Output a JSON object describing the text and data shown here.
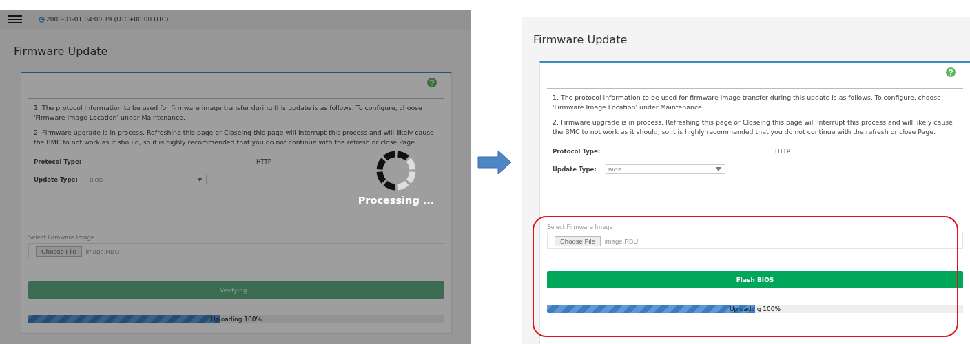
{
  "panels": [
    {
      "kind": "processing",
      "topbar": {
        "timestamp": "2000-01-01 04:00:19 (UTC+00:00 UTC)"
      },
      "title": "Firmware Update",
      "highlighted": false,
      "notes": [
        "1. The protocol information to be used for firmware image transfer during this update is as follows. To configure, choose 'Firmware Image Location' under Maintenance.",
        "2. Firmware upgrade is in process. Refreshing this page or Closeing this page will interrupt this process and will likely cause the BMC to not work as it should, so it is highly recommended that you do not continue with the refresh or close Page."
      ],
      "fields": [
        {
          "kind": "text",
          "label": "Protocol Type:",
          "value": "HTTP"
        },
        {
          "kind": "select",
          "label": "Update Type:",
          "value": "BIOS"
        }
      ],
      "file": {
        "label": "Select Firmware Image",
        "button": "Choose File",
        "filename": "image.RBU"
      },
      "action": {
        "label": "Verifying...",
        "disabled": true
      },
      "progress": {
        "level": 0.46,
        "text": "Uploading 100%"
      },
      "overlay": {
        "text": "Processing ..."
      }
    },
    {
      "kind": "ready",
      "title": "Firmware Update",
      "highlighted": true,
      "notes": [
        "1. The protocol information to be used for firmware image transfer during this update is as follows. To configure, choose 'Firmware Image Location' under Maintenance.",
        "2. Firmware upgrade is in process. Refreshing this page or Closeing this page will interrupt this process and will likely cause the BMC to not work as it should, so it is highly recommended that you do not continue with the refresh or close Page."
      ],
      "fields": [
        {
          "kind": "text",
          "label": "Protocol Type:",
          "value": "HTTP"
        },
        {
          "kind": "select",
          "label": "Update Type:",
          "value": "BIOS"
        }
      ],
      "file": {
        "label": "Select Firmware Image",
        "button": "Choose File",
        "filename": "image.RBU"
      },
      "action": {
        "label": "Flash BIOS",
        "disabled": false
      },
      "progress": {
        "level": 0.5,
        "text": "Uploading 100%"
      }
    }
  ]
}
